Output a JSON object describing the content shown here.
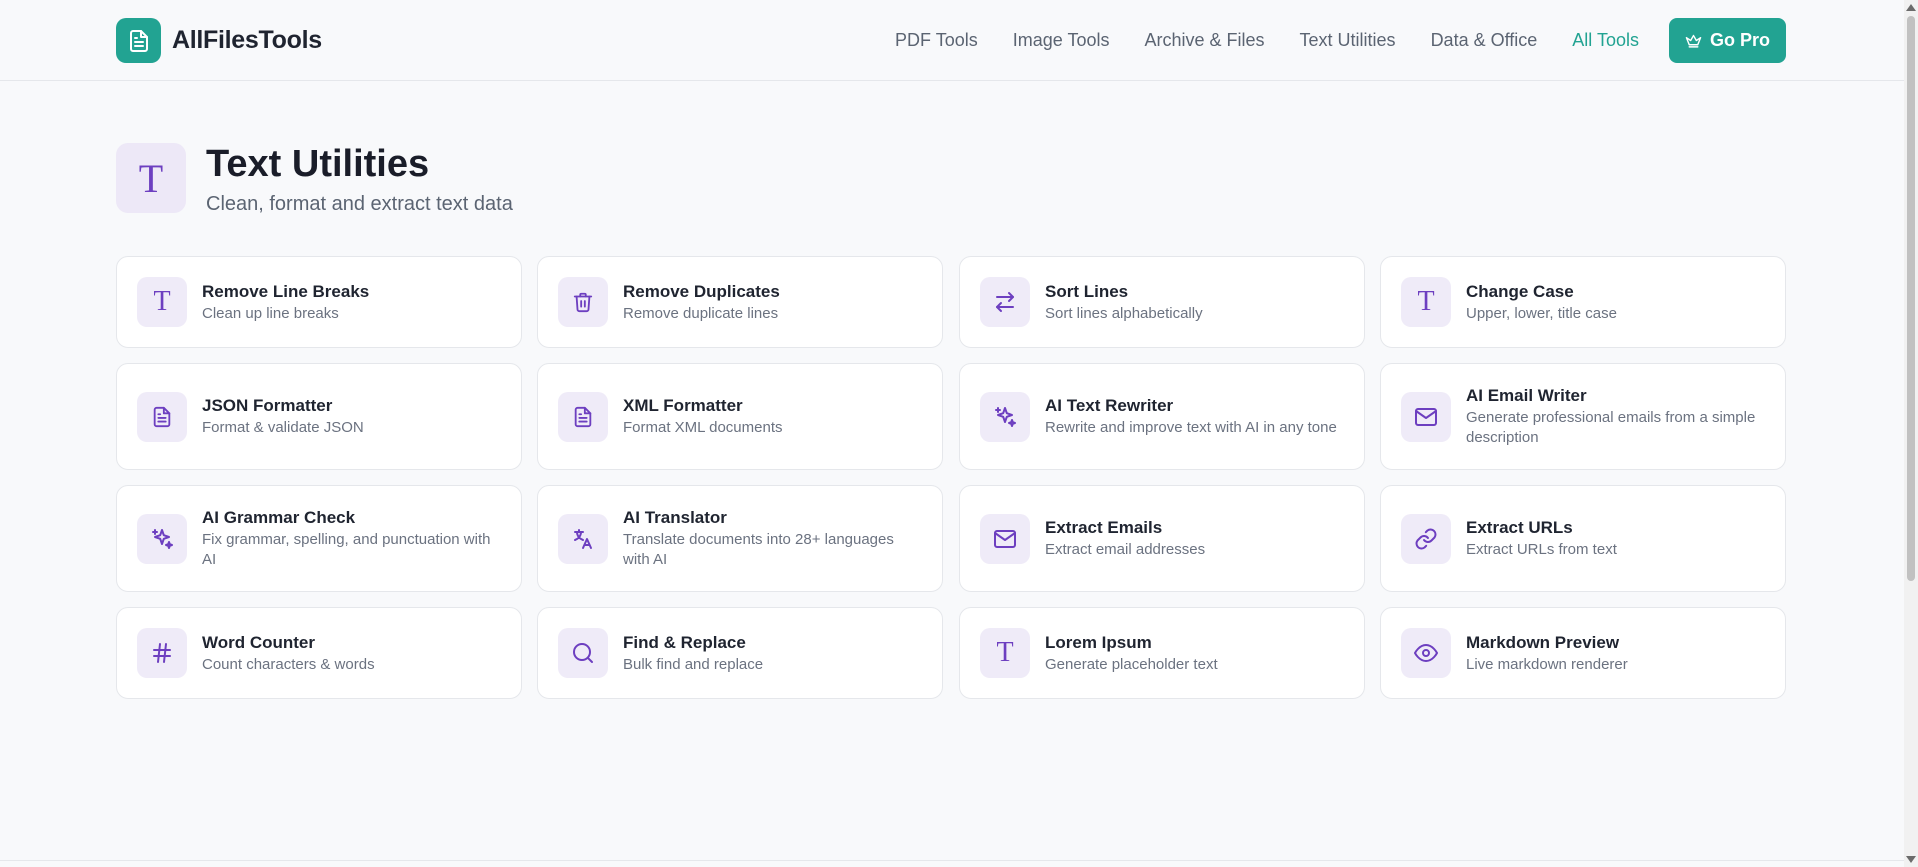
{
  "app": {
    "name": "AllFilesTools"
  },
  "nav": {
    "links": [
      "PDF Tools",
      "Image Tools",
      "Archive & Files",
      "Text Utilities",
      "Data & Office",
      "All Tools"
    ],
    "active": "All Tools",
    "cta": "Go Pro"
  },
  "page": {
    "title": "Text Utilities",
    "subtitle": "Clean, format and extract text data",
    "icon": "T"
  },
  "colors": {
    "brand": "#22a392",
    "accent_purple": "#6d3fc0",
    "icon_bg": "#efebf8"
  },
  "tools": [
    {
      "title": "Remove Line Breaks",
      "desc": "Clean up line breaks",
      "icon": "text-icon"
    },
    {
      "title": "Remove Duplicates",
      "desc": "Remove duplicate lines",
      "icon": "trash-icon"
    },
    {
      "title": "Sort Lines",
      "desc": "Sort lines alphabetically",
      "icon": "swap-arrows-icon"
    },
    {
      "title": "Change Case",
      "desc": "Upper, lower, title case",
      "icon": "text-icon"
    },
    {
      "title": "JSON Formatter",
      "desc": "Format & validate JSON",
      "icon": "file-text-icon"
    },
    {
      "title": "XML Formatter",
      "desc": "Format XML documents",
      "icon": "file-text-icon"
    },
    {
      "title": "AI Text Rewriter",
      "desc": "Rewrite and improve text with AI in any tone",
      "icon": "sparkles-icon"
    },
    {
      "title": "AI Email Writer",
      "desc": "Generate professional emails from a simple description",
      "icon": "mail-icon"
    },
    {
      "title": "AI Grammar Check",
      "desc": "Fix grammar, spelling, and punctuation with AI",
      "icon": "sparkles-icon"
    },
    {
      "title": "AI Translator",
      "desc": "Translate documents into 28+ languages with AI",
      "icon": "translate-icon"
    },
    {
      "title": "Extract Emails",
      "desc": "Extract email addresses",
      "icon": "mail-icon"
    },
    {
      "title": "Extract URLs",
      "desc": "Extract URLs from text",
      "icon": "link-icon"
    },
    {
      "title": "Word Counter",
      "desc": "Count characters & words",
      "icon": "hash-icon"
    },
    {
      "title": "Find & Replace",
      "desc": "Bulk find and replace",
      "icon": "search-icon"
    },
    {
      "title": "Lorem Ipsum",
      "desc": "Generate placeholder text",
      "icon": "text-icon"
    },
    {
      "title": "Markdown Preview",
      "desc": "Live markdown renderer",
      "icon": "eye-icon"
    }
  ]
}
